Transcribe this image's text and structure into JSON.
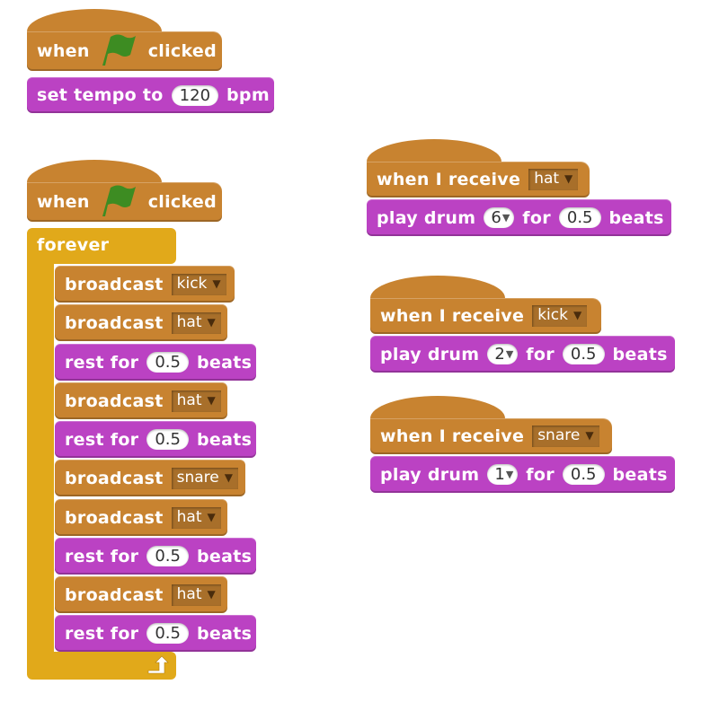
{
  "colors": {
    "events": "#c88330",
    "sound": "#bb42c3",
    "control": "#e1a91a",
    "flag": "#3d8c22"
  },
  "script1": {
    "hat": {
      "when": "when",
      "icon": "green-flag-icon",
      "clicked": "clicked"
    },
    "set_tempo": {
      "prefix": "set tempo to",
      "value": "120",
      "suffix": "bpm"
    }
  },
  "script2": {
    "hat": {
      "when": "when",
      "icon": "green-flag-icon",
      "clicked": "clicked"
    },
    "forever_label": "forever",
    "body": [
      {
        "type": "broadcast",
        "label": "broadcast",
        "message": "kick"
      },
      {
        "type": "broadcast",
        "label": "broadcast",
        "message": "hat"
      },
      {
        "type": "rest",
        "label": "rest for",
        "value": "0.5",
        "suffix": "beats"
      },
      {
        "type": "broadcast",
        "label": "broadcast",
        "message": "hat"
      },
      {
        "type": "rest",
        "label": "rest for",
        "value": "0.5",
        "suffix": "beats"
      },
      {
        "type": "broadcast",
        "label": "broadcast",
        "message": "snare"
      },
      {
        "type": "broadcast",
        "label": "broadcast",
        "message": "hat"
      },
      {
        "type": "rest",
        "label": "rest for",
        "value": "0.5",
        "suffix": "beats"
      },
      {
        "type": "broadcast",
        "label": "broadcast",
        "message": "hat"
      },
      {
        "type": "rest",
        "label": "rest for",
        "value": "0.5",
        "suffix": "beats"
      }
    ]
  },
  "receivers": [
    {
      "hat_label": "when I receive",
      "message": "hat",
      "play_label": "play drum",
      "drum": "6",
      "for_label": "for",
      "beats": "0.5",
      "beats_label": "beats"
    },
    {
      "hat_label": "when I receive",
      "message": "kick",
      "play_label": "play drum",
      "drum": "2",
      "for_label": "for",
      "beats": "0.5",
      "beats_label": "beats"
    },
    {
      "hat_label": "when I receive",
      "message": "snare",
      "play_label": "play drum",
      "drum": "1",
      "for_label": "for",
      "beats": "0.5",
      "beats_label": "beats"
    }
  ]
}
